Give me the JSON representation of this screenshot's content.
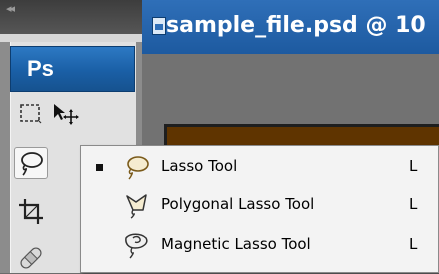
{
  "app": {
    "logo_text": "Ps",
    "collapse_glyph": "◂◂"
  },
  "document": {
    "tab_title": "sample_file.psd @ 10"
  },
  "toolbar": {
    "tools": [
      {
        "name": "rectangular-marquee-tool",
        "icon": "marquee-icon"
      },
      {
        "name": "move-tool",
        "icon": "move-icon"
      },
      {
        "name": "lasso-tool",
        "icon": "lasso-icon",
        "active": true
      },
      {
        "name": "crop-tool",
        "icon": "crop-icon"
      },
      {
        "name": "healing-brush-tool",
        "icon": "bandage-icon"
      }
    ]
  },
  "flyout": {
    "items": [
      {
        "label": "Lasso Tool",
        "shortcut": "L",
        "selected": true,
        "icon": "lasso-icon"
      },
      {
        "label": "Polygonal Lasso Tool",
        "shortcut": "L",
        "selected": false,
        "icon": "polygonal-lasso-icon"
      },
      {
        "label": "Magnetic Lasso Tool",
        "shortcut": "L",
        "selected": false,
        "icon": "magnetic-lasso-icon"
      }
    ]
  },
  "colors": {
    "accent_blue": "#1d5aa0",
    "canvas_brown": "#5f3400",
    "menu_background": "#f3f3f3"
  }
}
